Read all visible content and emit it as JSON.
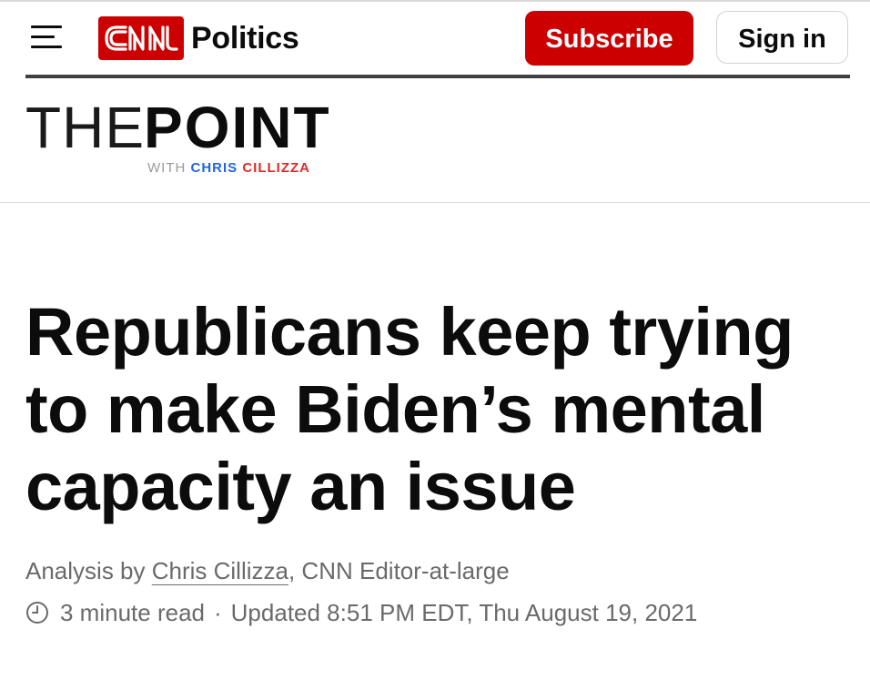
{
  "header": {
    "logo_text": "CNN",
    "section": "Politics",
    "subscribe_label": "Subscribe",
    "signin_label": "Sign in",
    "menu_icon": "hamburger-menu-icon",
    "brand_color": "#cc0000"
  },
  "branding": {
    "the": "THE",
    "point": "POINT",
    "with": "WITH",
    "author_first": "CHRIS",
    "author_last": "CILLIZZA",
    "colors": {
      "first": "#2266dd",
      "last": "#dd2a2a"
    }
  },
  "article": {
    "headline": "Republicans keep trying to make Biden’s mental capacity an issue",
    "byline_prefix": "Analysis by",
    "author": "Chris Cillizza",
    "author_role": ", CNN Editor-at-large",
    "read_time": "3 minute read",
    "separator": "·",
    "updated": "Updated 8:51 PM EDT, Thu August 19, 2021",
    "clock_icon": "clock-icon"
  }
}
